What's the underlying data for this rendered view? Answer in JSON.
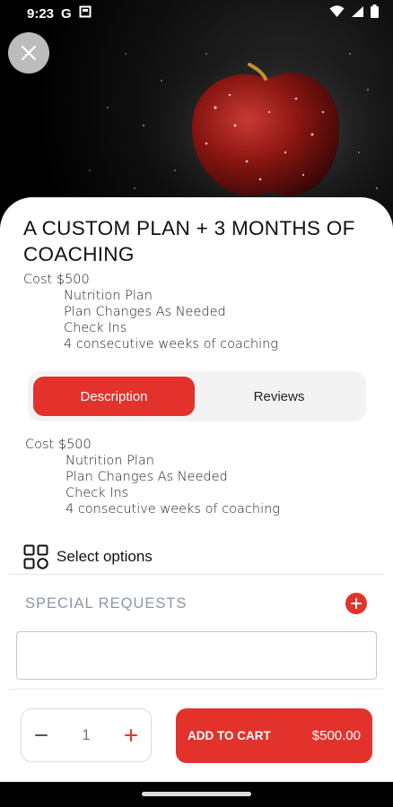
{
  "status_bar": {
    "time": "9:23",
    "carrier_icon": "G",
    "icons": [
      "google-icon",
      "screenshot-icon",
      "wifi-icon",
      "signal-icon",
      "battery-icon"
    ]
  },
  "hero": {
    "image": "red-apple-photo",
    "close_icon": "close-icon"
  },
  "product": {
    "title": "A CUSTOM PLAN + 3 MONTHS OF COACHING",
    "description": {
      "cost": "Cost $500",
      "items": [
        "Nutrition Plan",
        "Plan Changes As Needed",
        "Check Ins",
        "4 consecutive weeks of coaching"
      ]
    }
  },
  "tabs": [
    {
      "label": "Description",
      "active": true
    },
    {
      "label": "Reviews",
      "active": false
    }
  ],
  "options": {
    "label": "Select options",
    "icon": "grid-options-icon"
  },
  "special_requests": {
    "label": "SPECIAL REQUESTS",
    "input_value": "",
    "add_icon": "plus-circle-icon"
  },
  "cart": {
    "quantity": "1",
    "decrement_icon": "minus-icon",
    "increment_icon": "plus-icon",
    "button_label": "ADD TO CART",
    "price": "$500.00"
  },
  "colors": {
    "accent": "#e3322c",
    "muted_label": "#8a96a6"
  }
}
